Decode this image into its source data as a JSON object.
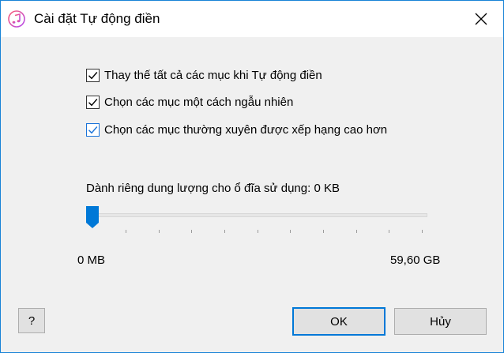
{
  "window": {
    "title": "Cài đặt Tự động điền"
  },
  "options": [
    {
      "label": "Thay thế tất cả các mục khi Tự động điền",
      "checked": true
    },
    {
      "label": "Chọn các mục một cách ngẫu nhiên",
      "checked": true
    },
    {
      "label": "Chọn các mục thường xuyên được xếp hạng cao hơn",
      "checked": true
    }
  ],
  "disk": {
    "label": "Dành riêng dung lượng cho ổ đĩa sử dụng: 0 KB",
    "min_label": "0 MB",
    "max_label": "59,60 GB",
    "value_fraction": 0
  },
  "buttons": {
    "help": "?",
    "ok": "OK",
    "cancel": "Hủy"
  },
  "colors": {
    "accent": "#0078d7",
    "border": "#1883d7",
    "background": "#f0f0f0"
  },
  "icons": {
    "app": "itunes-music-note-icon",
    "close": "close-icon"
  }
}
